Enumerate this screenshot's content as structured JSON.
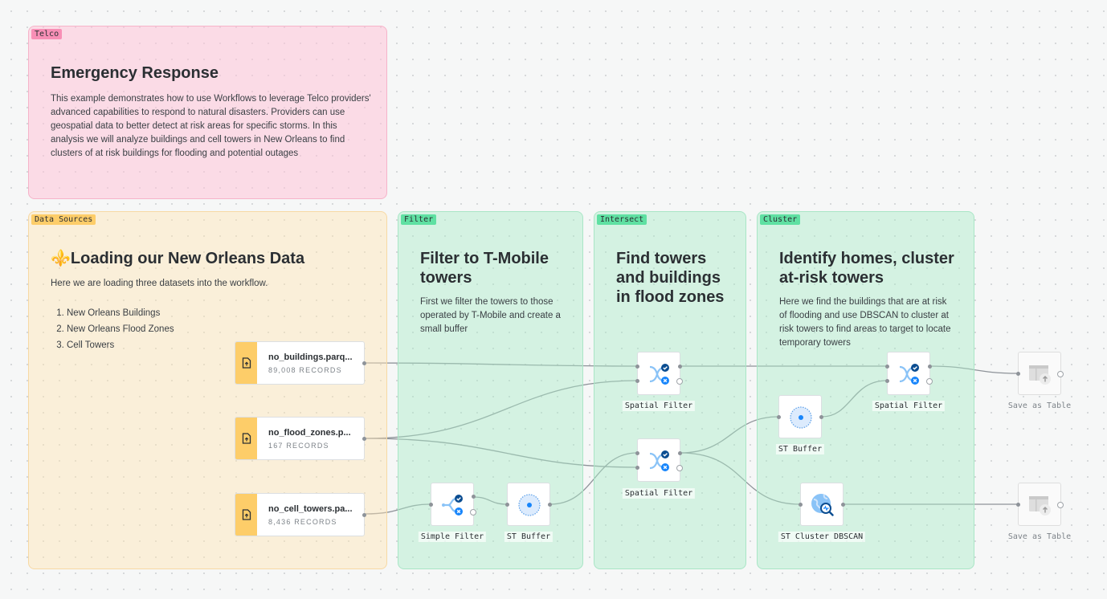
{
  "groups": {
    "telco": {
      "tag": "Telco",
      "title": "Emergency Response",
      "body": "This example demonstrates how to use Workflows to leverage Telco providers' advanced capabilities to respond to natural disasters. Providers can use geospatial data to better detect at risk areas for specific storms. In this analysis we will analyze buildings and cell towers in New Orleans to find clusters of at risk buildings for flooding and potential outages"
    },
    "data_sources": {
      "tag": "Data Sources",
      "title_icon": "⚜️",
      "title": "Loading our New Orleans Data",
      "body": "Here we are loading three datasets into the workflow.",
      "list": [
        "New Orleans Buildings",
        "New Orleans Flood Zones",
        "Cell Towers"
      ]
    },
    "filter": {
      "tag": "Filter",
      "title": "Filter to T-Mobile towers",
      "body": "First we filter the towers to those operated by T-Mobile and create a small buffer"
    },
    "intersect": {
      "tag": "Intersect",
      "title": "Find towers and buildings in flood zones"
    },
    "cluster": {
      "tag": "Cluster",
      "title": "Identify homes, cluster at-risk towers",
      "body": "Here we find the buildings that are at risk of flooding and use DBSCAN to cluster at risk towers to find areas to target to locate temporary towers"
    }
  },
  "sources": [
    {
      "name": "no_buildings.parq...",
      "records": "89,008 RECORDS",
      "icon": "file-upload-icon"
    },
    {
      "name": "no_flood_zones.p...",
      "records": "167 RECORDS",
      "icon": "file-upload-icon"
    },
    {
      "name": "no_cell_towers.pa...",
      "records": "8,436 RECORDS",
      "icon": "file-upload-icon"
    }
  ],
  "nodes": {
    "simple_filter": {
      "label": "Simple Filter",
      "icon": "simple-filter-icon"
    },
    "st_buffer_1": {
      "label": "ST Buffer",
      "icon": "buffer-icon"
    },
    "spatial_filter_1": {
      "label": "Spatial Filter",
      "icon": "spatial-filter-icon"
    },
    "spatial_filter_2": {
      "label": "Spatial Filter",
      "icon": "spatial-filter-icon"
    },
    "st_buffer_2": {
      "label": "ST Buffer",
      "icon": "buffer-icon"
    },
    "spatial_filter_3": {
      "label": "Spatial Filter",
      "icon": "spatial-filter-icon"
    },
    "st_cluster_dbscan": {
      "label": "ST Cluster DBSCAN",
      "icon": "globe-search-icon"
    },
    "save_table_1": {
      "label": "Save as Table",
      "icon": "save-table-icon",
      "state": "disabled"
    },
    "save_table_2": {
      "label": "Save as Table",
      "icon": "save-table-icon",
      "state": "disabled"
    }
  },
  "colors": {
    "pink_group": "#f88fb6",
    "yellow_group": "#fdcd69",
    "green_group": "#5fe0a2",
    "icon_blue": "#1785fb",
    "icon_dark_blue": "#0b4d91"
  }
}
